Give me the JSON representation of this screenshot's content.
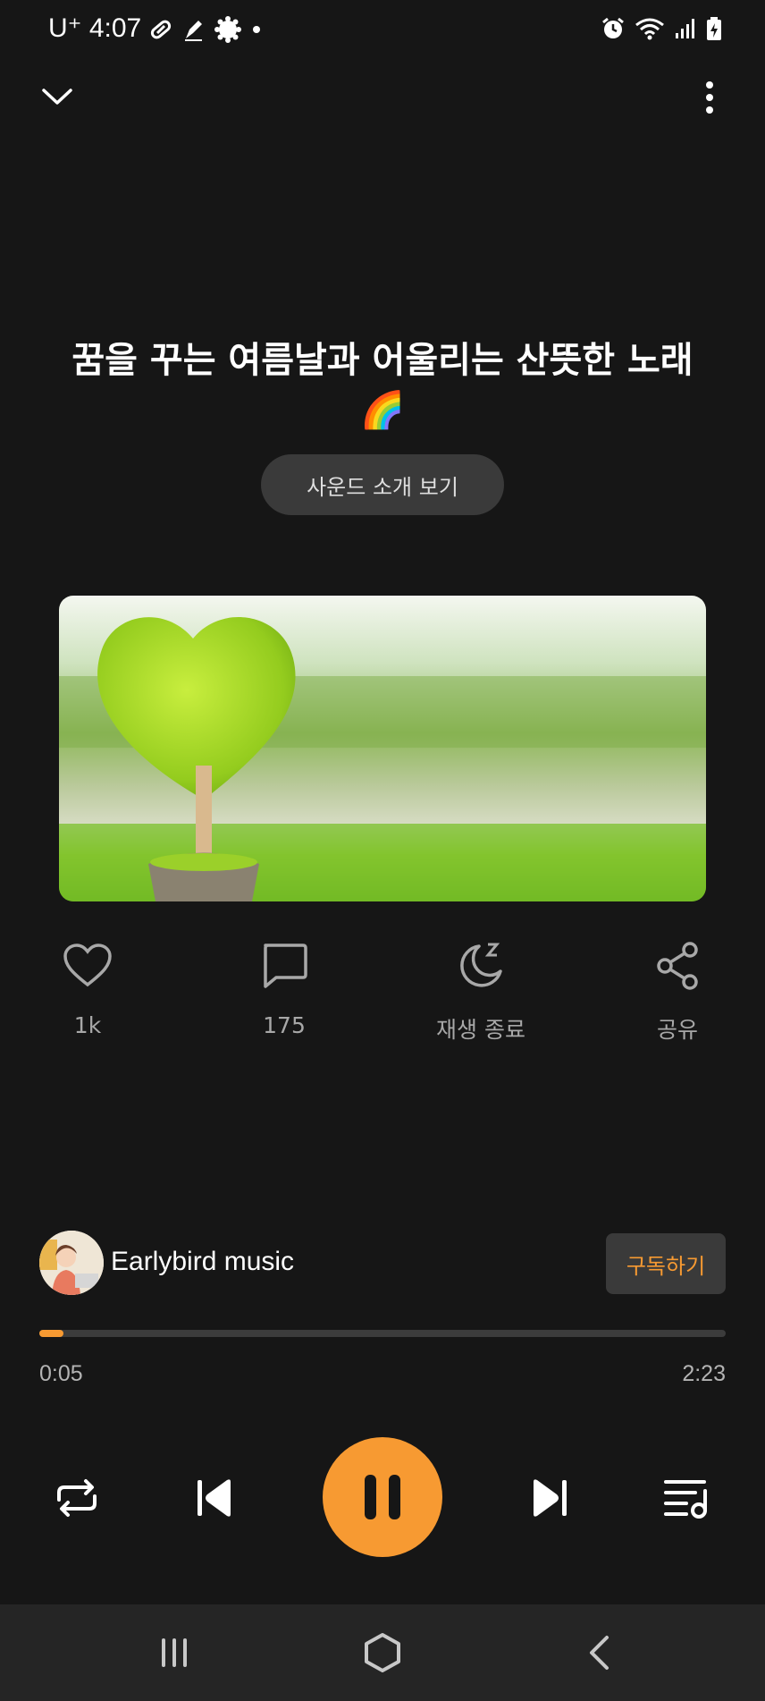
{
  "status_bar": {
    "carrier": "U⁺",
    "time": "4:07",
    "left_icons": [
      "pill-icon",
      "pen-icon",
      "settings-badge-icon",
      "dot-icon"
    ],
    "right_icons": [
      "alarm-icon",
      "wifi-icon",
      "signal-icon",
      "battery-icon"
    ]
  },
  "header": {
    "collapse_icon": "chevron-down-icon",
    "menu_icon": "more-vertical-icon"
  },
  "track": {
    "title": "꿈을 꾸는 여름날과 어울리는 산뜻한 노래🌈",
    "intro_button": "사운드 소개 보기"
  },
  "actions": {
    "like_count": "1k",
    "comment_count": "175",
    "sleep_label": "재생 종료",
    "share_label": "공유"
  },
  "channel": {
    "name": "Earlybird music",
    "subscribe_label": "구독하기"
  },
  "progress": {
    "elapsed": "0:05",
    "duration": "2:23",
    "fraction": 0.035
  },
  "colors": {
    "accent": "#f79a32",
    "background": "#161616"
  }
}
